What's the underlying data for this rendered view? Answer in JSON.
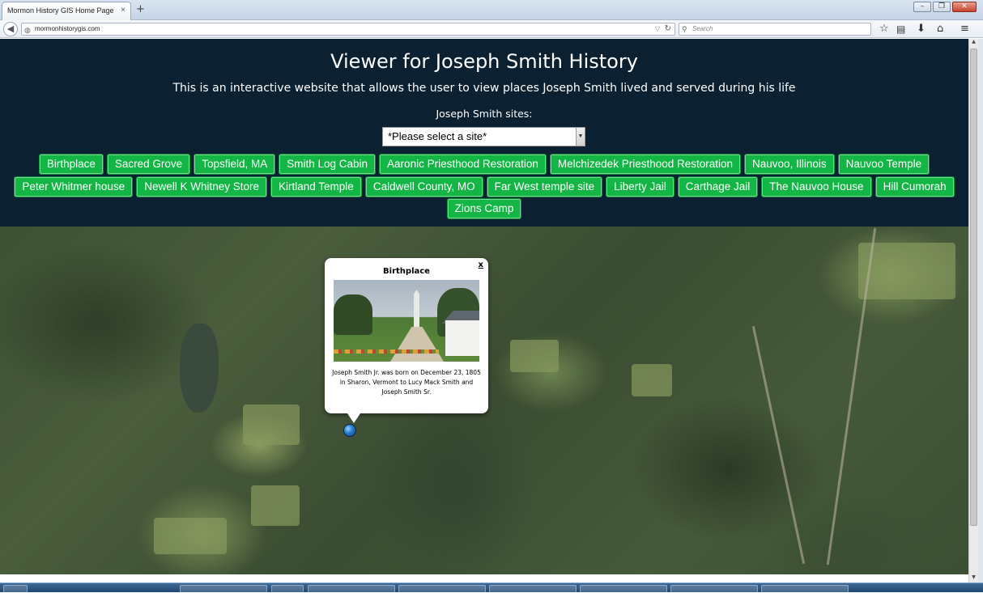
{
  "browser": {
    "tab_title": "Mormon History GIS Home Page",
    "tab_close": "×",
    "new_tab": "+",
    "url": "mormonhistorygis.com",
    "search_placeholder": "Search",
    "icons": [
      "back-arrow-icon",
      "globe-icon",
      "reload-icon",
      "search-icon",
      "star-icon",
      "reading-list-icon",
      "download-icon",
      "home-icon",
      "menu-icon"
    ]
  },
  "page": {
    "title": "Viewer for Joseph Smith History",
    "subtitle": "This is an interactive website that allows the user to view places Joseph Smith lived and served during his life",
    "sites_label": "Joseph Smith sites:",
    "select_value": "*Please select a site*",
    "button_rows": [
      [
        "Birthplace",
        "Sacred Grove",
        "Topsfield, MA",
        "Smith Log Cabin",
        "Aaronic Priesthood Restoration",
        "Melchizedek Priesthood Restoration",
        "Nauvoo, Illinois",
        "Nauvoo Temple"
      ],
      [
        "Peter Whitmer house",
        "Newell K Whitney Store",
        "Kirtland Temple",
        "Caldwell County, MO",
        "Far West temple site",
        "Liberty Jail",
        "Carthage Jail",
        "The Nauvoo House",
        "Hill Cumorah"
      ],
      [
        "Zions Camp"
      ]
    ],
    "button_color": "#13b544",
    "header_bg": "#0b2132"
  },
  "popup": {
    "title": "Birthplace",
    "close": "x",
    "description": "Joseph Smith Jr. was born on December 23, 1805 in Sharon, Vermont to Lucy Mack Smith and Joseph Smith Sr."
  }
}
